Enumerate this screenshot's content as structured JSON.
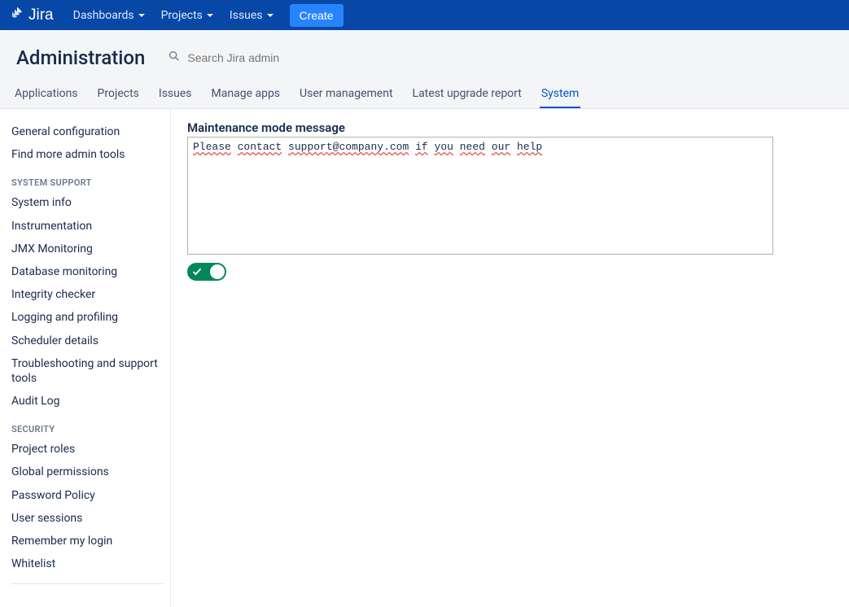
{
  "topnav": {
    "logo_text": "Jira",
    "items": [
      {
        "label": "Dashboards"
      },
      {
        "label": "Projects"
      },
      {
        "label": "Issues"
      }
    ],
    "create_label": "Create"
  },
  "header": {
    "title": "Administration",
    "search_placeholder": "Search Jira admin"
  },
  "tabs": [
    {
      "label": "Applications",
      "active": false
    },
    {
      "label": "Projects",
      "active": false
    },
    {
      "label": "Issues",
      "active": false
    },
    {
      "label": "Manage apps",
      "active": false
    },
    {
      "label": "User management",
      "active": false
    },
    {
      "label": "Latest upgrade report",
      "active": false
    },
    {
      "label": "System",
      "active": true
    }
  ],
  "sidebar": {
    "top_items": [
      "General configuration",
      "Find more admin tools"
    ],
    "groups": [
      {
        "heading": "SYSTEM SUPPORT",
        "items": [
          "System info",
          "Instrumentation",
          "JMX Monitoring",
          "Database monitoring",
          "Integrity checker",
          "Logging and profiling",
          "Scheduler details",
          "Troubleshooting and support tools",
          "Audit Log"
        ]
      },
      {
        "heading": "SECURITY",
        "items": [
          "Project roles",
          "Global permissions",
          "Password Policy",
          "User sessions",
          "Remember my login",
          "Whitelist"
        ]
      }
    ]
  },
  "main": {
    "field_label": "Maintenance mode message",
    "message_value": "Please contact support@company.com if you need our help",
    "toggle_on": true
  }
}
